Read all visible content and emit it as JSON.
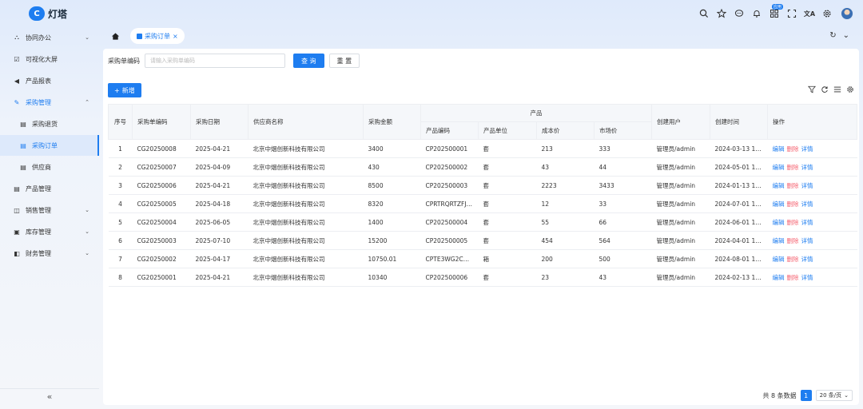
{
  "app": {
    "name": "灯塔",
    "logo_glyph": "C"
  },
  "header_icons": [
    {
      "name": "search-icon",
      "glyph": "⌕"
    },
    {
      "name": "star-icon",
      "glyph": "☆"
    },
    {
      "name": "chat-icon",
      "glyph": "💬"
    },
    {
      "name": "bell-icon",
      "glyph": "🔔"
    },
    {
      "name": "apps-icon",
      "glyph": "⊞",
      "badge": "应用"
    },
    {
      "name": "fullscreen-icon",
      "glyph": "⛶"
    },
    {
      "name": "translate-icon",
      "glyph": "文A"
    },
    {
      "name": "settings-icon",
      "glyph": "⚙"
    }
  ],
  "sidebar": {
    "items": [
      {
        "label": "协同办公",
        "icon": "⛬",
        "chevron": "⌄"
      },
      {
        "label": "可视化大屏",
        "icon": "☑",
        "chevron": ""
      },
      {
        "label": "产品报表",
        "icon": "◀",
        "chevron": ""
      },
      {
        "label": "采购管理",
        "icon": "✎",
        "chevron": "⌃"
      },
      {
        "label": "采购退货",
        "icon": "▤",
        "chevron": ""
      },
      {
        "label": "采购订单",
        "icon": "▤",
        "chevron": ""
      },
      {
        "label": "供应商",
        "icon": "▤",
        "chevron": ""
      },
      {
        "label": "产品管理",
        "icon": "▤",
        "chevron": ""
      },
      {
        "label": "销售管理",
        "icon": "◫",
        "chevron": "⌄"
      },
      {
        "label": "库存管理",
        "icon": "▣",
        "chevron": "⌄"
      },
      {
        "label": "财务管理",
        "icon": "◧",
        "chevron": "⌄"
      }
    ],
    "collapse_glyph": "«"
  },
  "tabs": {
    "home_glyph": "⌂",
    "active_label": "采购订单",
    "close_glyph": "×",
    "refresh_glyph": "↻",
    "more_glyph": "⌄"
  },
  "search": {
    "label": "采购单编码",
    "placeholder": "请输入采购单编码",
    "query_label": "查 询",
    "reset_label": "重 置"
  },
  "add_label": "新增",
  "table_tool_icons": [
    "filter-icon",
    "refresh-icon",
    "columns-icon",
    "settings-icon"
  ],
  "table": {
    "headers": {
      "index": "序号",
      "code": "采购单编码",
      "date": "采购日期",
      "supplier": "供应商名称",
      "amount": "采购金额",
      "product": "产品",
      "product_code": "产品编码",
      "product_unit": "产品单位",
      "cost": "成本价",
      "market": "市场价",
      "creator": "创建用户",
      "created": "创建时间",
      "ops": "操作"
    },
    "rows": [
      {
        "index": "1",
        "code": "CG20250008",
        "date": "2025-04-21",
        "supplier": "北京中烟创新科技有限公司",
        "amount": "3400",
        "product_code": "CP202500001",
        "unit": "套",
        "cost": "213",
        "market": "333",
        "creator": "管理员/admin",
        "created": "2024-03-13 16:5..."
      },
      {
        "index": "2",
        "code": "CG20250007",
        "date": "2025-04-09",
        "supplier": "北京中烟创新科技有限公司",
        "amount": "430",
        "product_code": "CP202500002",
        "unit": "套",
        "cost": "43",
        "market": "44",
        "creator": "管理员/admin",
        "created": "2024-05-01 16:5..."
      },
      {
        "index": "3",
        "code": "CG20250006",
        "date": "2025-04-21",
        "supplier": "北京中烟创新科技有限公司",
        "amount": "8500",
        "product_code": "CP202500003",
        "unit": "套",
        "cost": "2223",
        "market": "3433",
        "creator": "管理员/admin",
        "created": "2024-01-13 16:5..."
      },
      {
        "index": "4",
        "code": "CG20250005",
        "date": "2025-04-18",
        "supplier": "北京中烟创新科技有限公司",
        "amount": "8320",
        "product_code": "CPRTRQRTZFJYF...",
        "unit": "套",
        "cost": "12",
        "market": "33",
        "creator": "管理员/admin",
        "created": "2024-07-01 16:5..."
      },
      {
        "index": "5",
        "code": "CG20250004",
        "date": "2025-06-05",
        "supplier": "北京中烟创新科技有限公司",
        "amount": "1400",
        "product_code": "CP202500004",
        "unit": "套",
        "cost": "55",
        "market": "66",
        "creator": "管理员/admin",
        "created": "2024-06-01 15:3..."
      },
      {
        "index": "6",
        "code": "CG20250003",
        "date": "2025-07-10",
        "supplier": "北京中烟创新科技有限公司",
        "amount": "15200",
        "product_code": "CP202500005",
        "unit": "套",
        "cost": "454",
        "market": "564",
        "creator": "管理员/admin",
        "created": "2024-04-01 15:5..."
      },
      {
        "index": "7",
        "code": "CG20250002",
        "date": "2025-04-17",
        "supplier": "北京中烟创新科技有限公司",
        "amount": "10750.01",
        "product_code": "CPTE3WG2CQG...",
        "unit": "箱",
        "cost": "200",
        "market": "500",
        "creator": "管理员/admin",
        "created": "2024-08-01 15:3..."
      },
      {
        "index": "8",
        "code": "CG20250001",
        "date": "2025-04-21",
        "supplier": "北京中烟创新科技有限公司",
        "amount": "10340",
        "product_code": "CP202500006",
        "unit": "套",
        "cost": "23",
        "market": "43",
        "creator": "管理员/admin",
        "created": "2024-02-13 15:3..."
      }
    ],
    "ops": {
      "edit": "编辑",
      "delete": "删除",
      "detail": "详情"
    }
  },
  "pagination": {
    "total_text": "共 8 条数据",
    "current_page": "1",
    "page_size": "20 条/页",
    "chevron": "⌄"
  },
  "colors": {
    "primary": "#1e7df0",
    "danger": "#f5616f"
  }
}
